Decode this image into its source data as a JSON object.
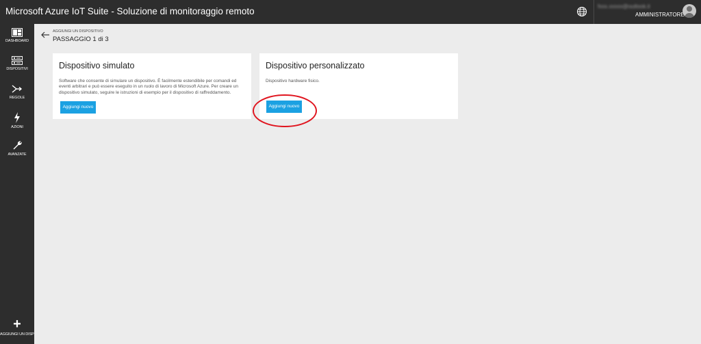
{
  "header": {
    "title": "Microsoft Azure IoT Suite - Soluzione di monitoraggio remoto",
    "user_email": "fxxx.xxxxx@outlook.it",
    "user_role": "AMMINISTRATORE"
  },
  "sidebar": {
    "items": [
      {
        "label": "DASHBOARD",
        "icon": "dashboard-icon"
      },
      {
        "label": "DISPOSITIVI",
        "icon": "devices-icon"
      },
      {
        "label": "REGOLE",
        "icon": "rules-icon"
      },
      {
        "label": "AZIONI",
        "icon": "lightning-icon"
      },
      {
        "label": "AVANZATE",
        "icon": "wrench-icon"
      }
    ],
    "add_device_label": "AGGIUNGI UN DISPO."
  },
  "breadcrumb": {
    "section": "AGGIUNGI UN DISPOSITIVO",
    "step": "PASSAGGIO 1 di 3"
  },
  "cards": [
    {
      "title": "Dispositivo simulato",
      "description": "Software che consente di simulare un dispositivo. È facilmente estendibile per comandi ed eventi arbitrari e può essere eseguito in un ruolo di lavoro di Microsoft Azure. Per creare un dispositivo simulato, seguire le istruzioni di esempio per il dispositivo di raffreddamento.",
      "button_label": "Aggiungi nuovo"
    },
    {
      "title": "Dispositivo personalizzato",
      "description": "Dispositivo hardware fisico.",
      "button_label": "Aggiungi nuovo"
    }
  ],
  "colors": {
    "topbar": "#2d2d2d",
    "sidebar": "#2d2d2d",
    "accent": "#1ba1e2",
    "highlight": "#e0141e"
  }
}
